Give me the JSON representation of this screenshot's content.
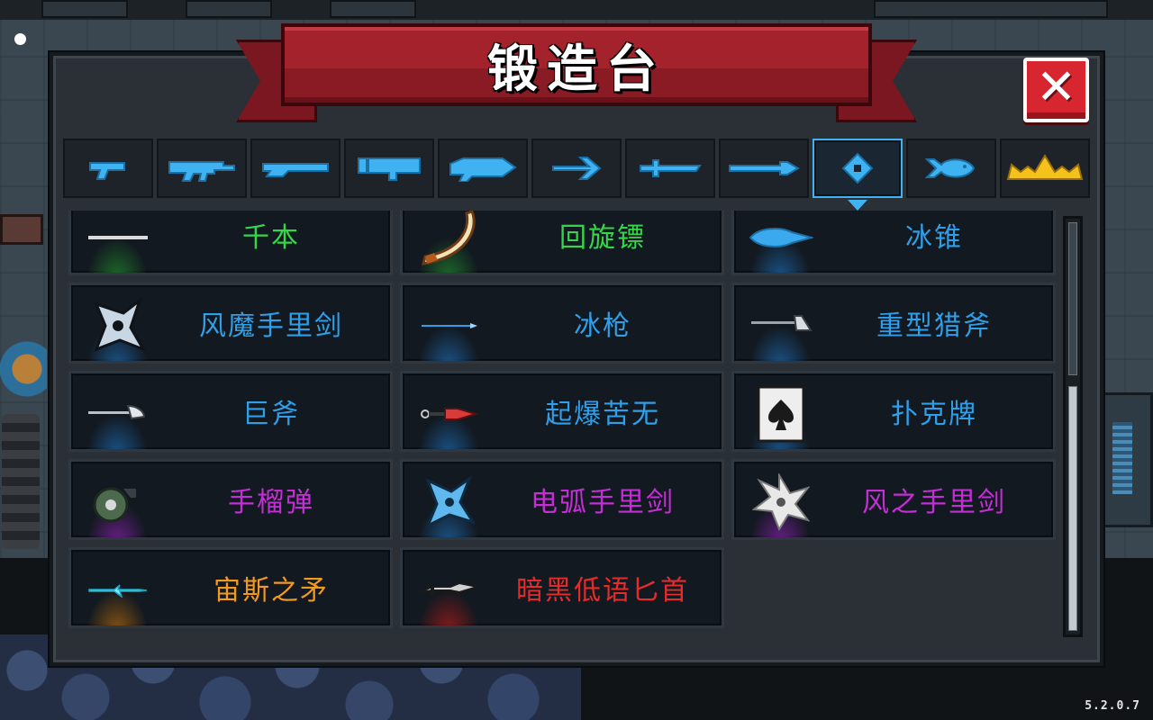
{
  "window": {
    "title": "锻造台",
    "version": "5.2.0.7"
  },
  "colors": {
    "banner": "#a3222c",
    "accent": "#3fb2f2",
    "close": "#d7262f",
    "tier_green": "#35d64a",
    "tier_blue": "#2e9fe8",
    "tier_purple": "#c52ed6",
    "tier_orange": "#f29a1e",
    "tier_red": "#e62b2b"
  },
  "tabs": [
    {
      "icon": "pistol-icon",
      "selected": false
    },
    {
      "icon": "assault-rifle-icon",
      "selected": false
    },
    {
      "icon": "shotgun-icon",
      "selected": false
    },
    {
      "icon": "rocket-launcher-icon",
      "selected": false
    },
    {
      "icon": "laser-gun-icon",
      "selected": false
    },
    {
      "icon": "bow-icon",
      "selected": false
    },
    {
      "icon": "sword-icon",
      "selected": false
    },
    {
      "icon": "spear-icon",
      "selected": false
    },
    {
      "icon": "shuriken-icon",
      "selected": true
    },
    {
      "icon": "fish-icon",
      "selected": false
    },
    {
      "icon": "crown-icon",
      "selected": false
    }
  ],
  "items": [
    {
      "name": "千本",
      "tier": "green",
      "icon": "senbon-needle-icon"
    },
    {
      "name": "回旋镖",
      "tier": "green",
      "icon": "boomerang-icon"
    },
    {
      "name": "冰锥",
      "tier": "blue",
      "icon": "ice-cone-icon"
    },
    {
      "name": "风魔手里剑",
      "tier": "blue",
      "icon": "fuma-shuriken-icon"
    },
    {
      "name": "冰枪",
      "tier": "blue",
      "icon": "ice-spear-icon"
    },
    {
      "name": "重型猎斧",
      "tier": "blue",
      "icon": "heavy-hunting-axe-icon"
    },
    {
      "name": "巨斧",
      "tier": "blue",
      "icon": "giant-axe-icon"
    },
    {
      "name": "起爆苦无",
      "tier": "blue",
      "icon": "explosive-kunai-icon"
    },
    {
      "name": "扑克牌",
      "tier": "blue",
      "icon": "poker-card-icon"
    },
    {
      "name": "手榴弹",
      "tier": "purple",
      "icon": "grenade-icon"
    },
    {
      "name": "电弧手里剑",
      "tier": "purple",
      "icon": "arc-shuriken-icon"
    },
    {
      "name": "风之手里剑",
      "tier": "purple",
      "icon": "wind-shuriken-icon"
    },
    {
      "name": "宙斯之矛",
      "tier": "orange",
      "icon": "zeus-spear-icon"
    },
    {
      "name": "暗黑低语匕首",
      "tier": "red",
      "icon": "dark-whisper-dagger-icon"
    }
  ]
}
